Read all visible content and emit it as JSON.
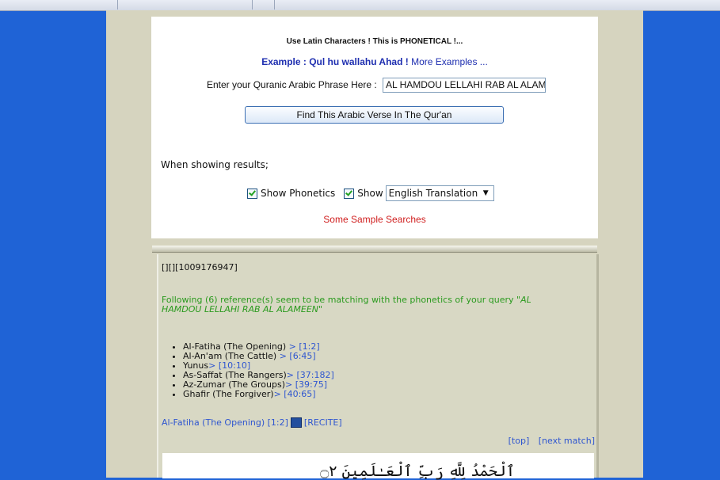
{
  "form": {
    "hint": "Use Latin Characters ! This is PHONETICAL !...",
    "example": "Example : Qul hu wallahu Ahad !",
    "more_examples": "More Examples ...",
    "phrase_label": "Enter your Quranic Arabic Phrase Here :",
    "phrase_value": "AL HAMDOU LELLAHI RAB AL ALAMEEN",
    "find_button": "Find This  Arabic Verse In The Qur'an",
    "when_showing": "When showing results;",
    "show_phonetics_label": "Show Phonetics",
    "show_label": "Show",
    "translation_select": "English Translation",
    "sample_searches": "Some Sample Searches"
  },
  "results": {
    "id_text": "[][][1009176947]",
    "following_prefix": "Following (6) reference(s) seem to be matching with the phonetics of your query",
    "query": "\"AL HAMDOU LELLAHI RAB AL ALAMEEN\"",
    "refs": [
      {
        "name": "Al-Fatiha (The Opening)",
        "ref": " > [1:2]"
      },
      {
        "name": "Al-An'am (The Cattle)",
        "ref": " > [6:45]"
      },
      {
        "name": "Yunus",
        "ref": "> [10:10]"
      },
      {
        "name": "As-Saffat (The Rangers)",
        "ref": "> [37:182]"
      },
      {
        "name": "Az-Zumar (The Groups)",
        "ref": "> [39:75]"
      },
      {
        "name": "Ghafir (The Forgiver)",
        "ref": "> [40:65]"
      }
    ],
    "match_title": "Al-Fatiha (The Opening) [1:2]",
    "recite": "[RECITE]",
    "top": "[top]",
    "next_match": "[next match]",
    "arabic": "ٱلْحَمْدُ لِلَّهِ رَبِّ ٱلْعَـٰلَمِينَ ۝٢"
  }
}
